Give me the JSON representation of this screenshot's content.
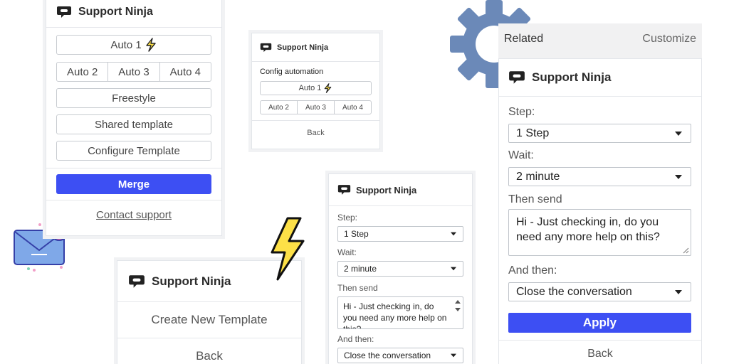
{
  "brand": "Support Ninja",
  "card1": {
    "auto1": "Auto 1",
    "autos": [
      "Auto 2",
      "Auto 3",
      "Auto 4"
    ],
    "freestyle": "Freestyle",
    "shared": "Shared template",
    "configure": "Configure Template",
    "merge": "Merge",
    "contact": "Contact support"
  },
  "card2": {
    "heading": "Config automation",
    "auto1": "Auto 1",
    "autos": [
      "Auto 2",
      "Auto 3",
      "Auto 4"
    ],
    "back": "Back"
  },
  "card3": {
    "create": "Create New Template",
    "back": "Back"
  },
  "form": {
    "step_label": "Step:",
    "step_value": "1 Step",
    "wait_label": "Wait:",
    "wait_value": "2 minute",
    "send_label": "Then send",
    "message": "Hi - Just checking in, do you need any more help on this?",
    "message_clipped": "Hi - Just checking in, do you need any more help on this?",
    "and_label": "And then:",
    "and_value": "Close the conversation",
    "apply": "Apply",
    "back": "Back"
  },
  "panel": {
    "related": "Related",
    "customize": "Customize"
  },
  "colors": {
    "accent": "#3d4ff3",
    "gear": "#6b89b8",
    "bolt": "#fde047",
    "envelope": "#7fa8e8",
    "badge": "#e86ab0"
  },
  "icons": [
    "chat-logo-icon",
    "lightning-icon",
    "gear-icon",
    "envelope-icon",
    "caret-down-icon"
  ]
}
